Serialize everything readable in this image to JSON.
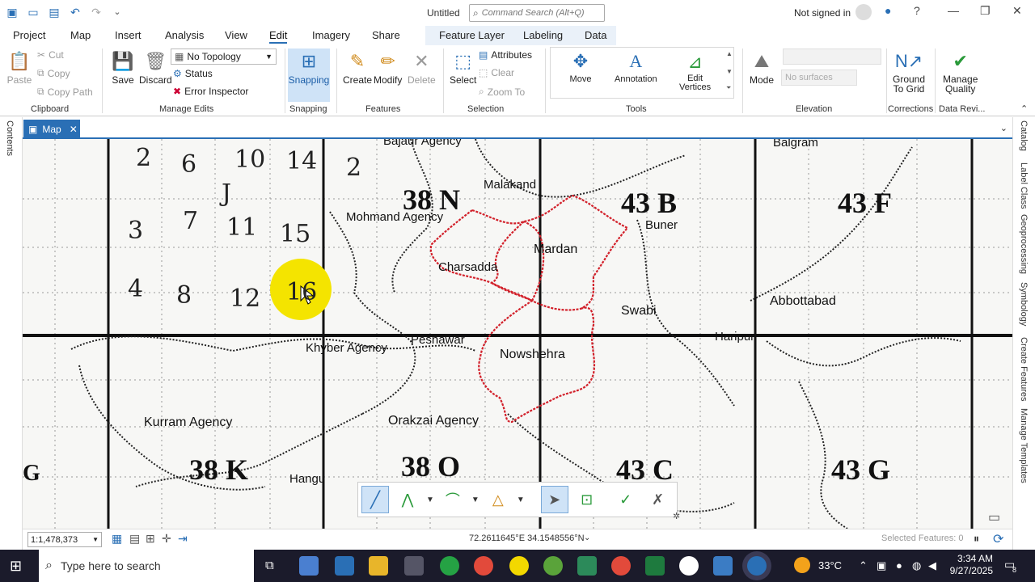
{
  "titlebar": {
    "title": "Untitled",
    "search_placeholder": "Command Search (Alt+Q)",
    "signin": "Not signed in"
  },
  "tabs": {
    "items": [
      "Project",
      "Map",
      "Insert",
      "Analysis",
      "View",
      "Edit",
      "Imagery",
      "Share"
    ],
    "active": "Edit",
    "contextual": [
      "Feature Layer",
      "Labeling",
      "Data"
    ]
  },
  "ribbon": {
    "clipboard": {
      "paste": "Paste",
      "cut": "Cut",
      "copy": "Copy",
      "copy_path": "Copy Path",
      "label": "Clipboard"
    },
    "manage_edits": {
      "save": "Save",
      "discard": "Discard",
      "topology": "No Topology",
      "status": "Status",
      "error_inspector": "Error Inspector",
      "label": "Manage Edits"
    },
    "snapping": {
      "snapping": "Snapping",
      "label": "Snapping"
    },
    "features": {
      "create": "Create",
      "modify": "Modify",
      "delete": "Delete",
      "label": "Features"
    },
    "selection": {
      "select": "Select",
      "attributes": "Attributes",
      "clear": "Clear",
      "zoom_to": "Zoom To",
      "label": "Selection"
    },
    "tools": {
      "move": "Move",
      "annotation": "Annotation",
      "edit_vertices_1": "Edit",
      "edit_vertices_2": "Vertices",
      "label": "Tools"
    },
    "elevation": {
      "mode": "Mode",
      "surfaces": "No surfaces",
      "label": "Elevation"
    },
    "corrections": {
      "ground_1": "Ground",
      "ground_2": "To Grid",
      "label": "Corrections"
    },
    "data_reviewer": {
      "manage_1": "Manage",
      "manage_2": "Quality",
      "label": "Data Revi..."
    }
  },
  "side": {
    "left": [
      "Contents"
    ],
    "right": [
      "Catalog",
      "Label Class",
      "Geoprocessing",
      "Symbology",
      "Create Features",
      "Manage Templates"
    ]
  },
  "map": {
    "tab": "Map",
    "grid_labels": [
      "38 N",
      "43 B",
      "43 F",
      "38 K",
      "38 O",
      "43 C",
      "43 G",
      "G"
    ],
    "place_labels": [
      "Bajaur Agency",
      "Malakand",
      "Mohmand Agency",
      "Buner",
      "Balgram",
      "Charsadda",
      "Mardan",
      "Swabi",
      "Abbottabad",
      "Peshawar",
      "Khyber Agency",
      "Nowshehra",
      "Haripur",
      "Kurram Agency",
      "Orakzai Agency",
      "Hangu"
    ],
    "handwritten": [
      "2",
      "6",
      "10",
      "14",
      "2",
      "3",
      "7",
      "11",
      "15",
      "4",
      "8",
      "12",
      "16",
      "J"
    ]
  },
  "statusbar": {
    "scale": "1:1,478,373",
    "coords": "72.2611645°E 34.1548556°N",
    "selected": "Selected Features: 0"
  },
  "taskbar": {
    "search": "Type here to search",
    "weather": "33°C",
    "time": "3:34 AM",
    "date": "9/27/2025",
    "notifications": "8"
  }
}
